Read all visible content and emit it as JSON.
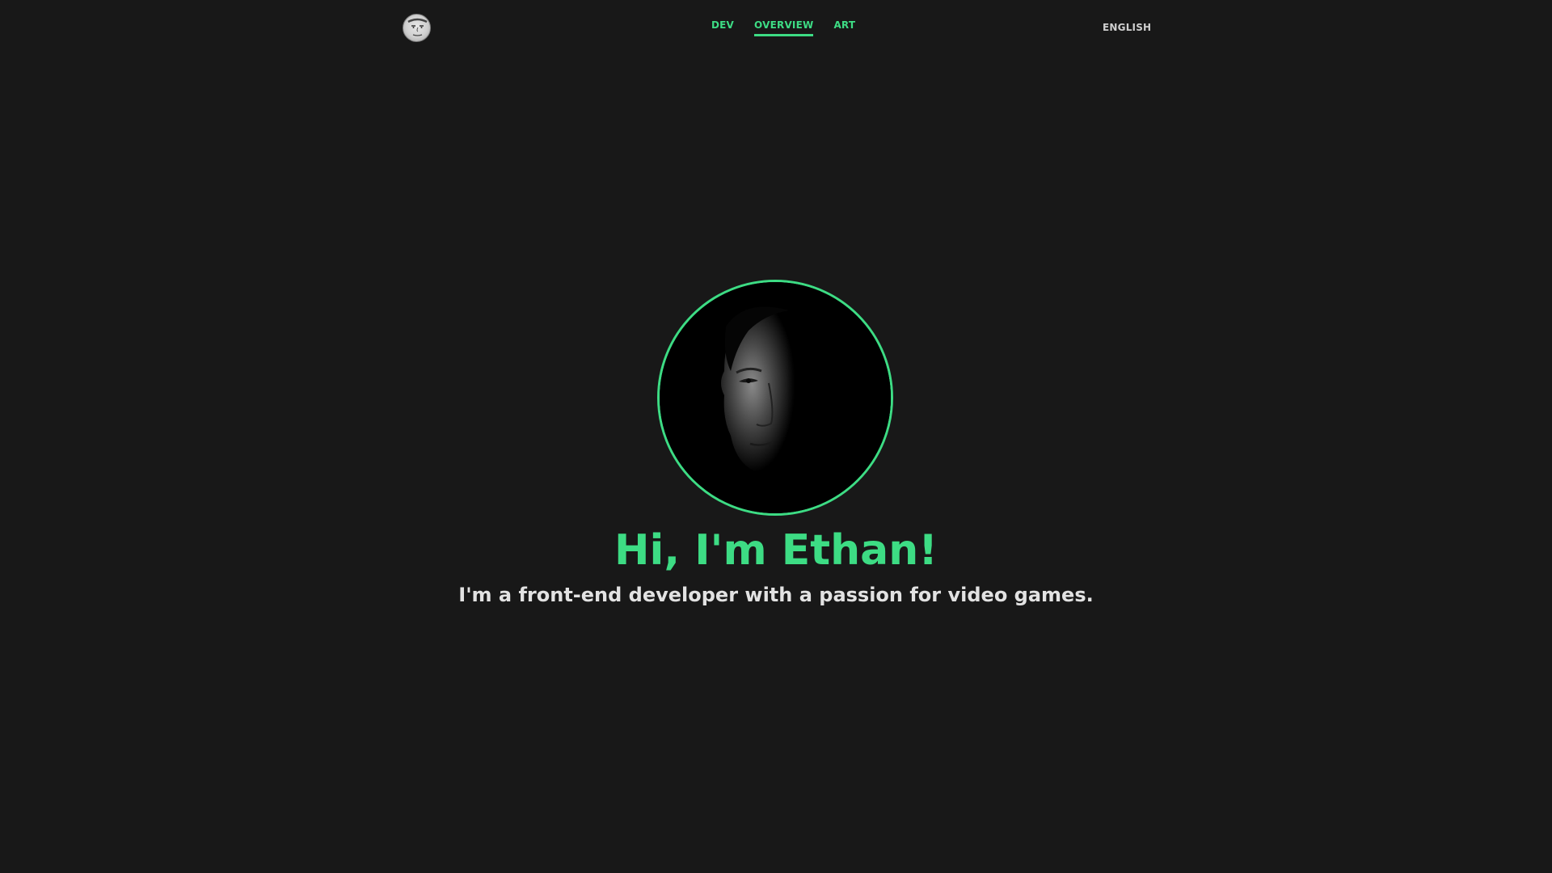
{
  "header": {
    "logo_icon": "cartoon-face-icon",
    "nav": [
      {
        "label": "DEV",
        "active": false
      },
      {
        "label": "OVERVIEW",
        "active": true
      },
      {
        "label": "ART",
        "active": false
      }
    ],
    "language": "ENGLISH"
  },
  "hero": {
    "title": "Hi, I'm Ethan!",
    "subtitle": "I'm a front-end developer with a passion for video games."
  },
  "colors": {
    "background": "#181818",
    "accent": "#3ddc84",
    "text": "#e2e2e2"
  }
}
